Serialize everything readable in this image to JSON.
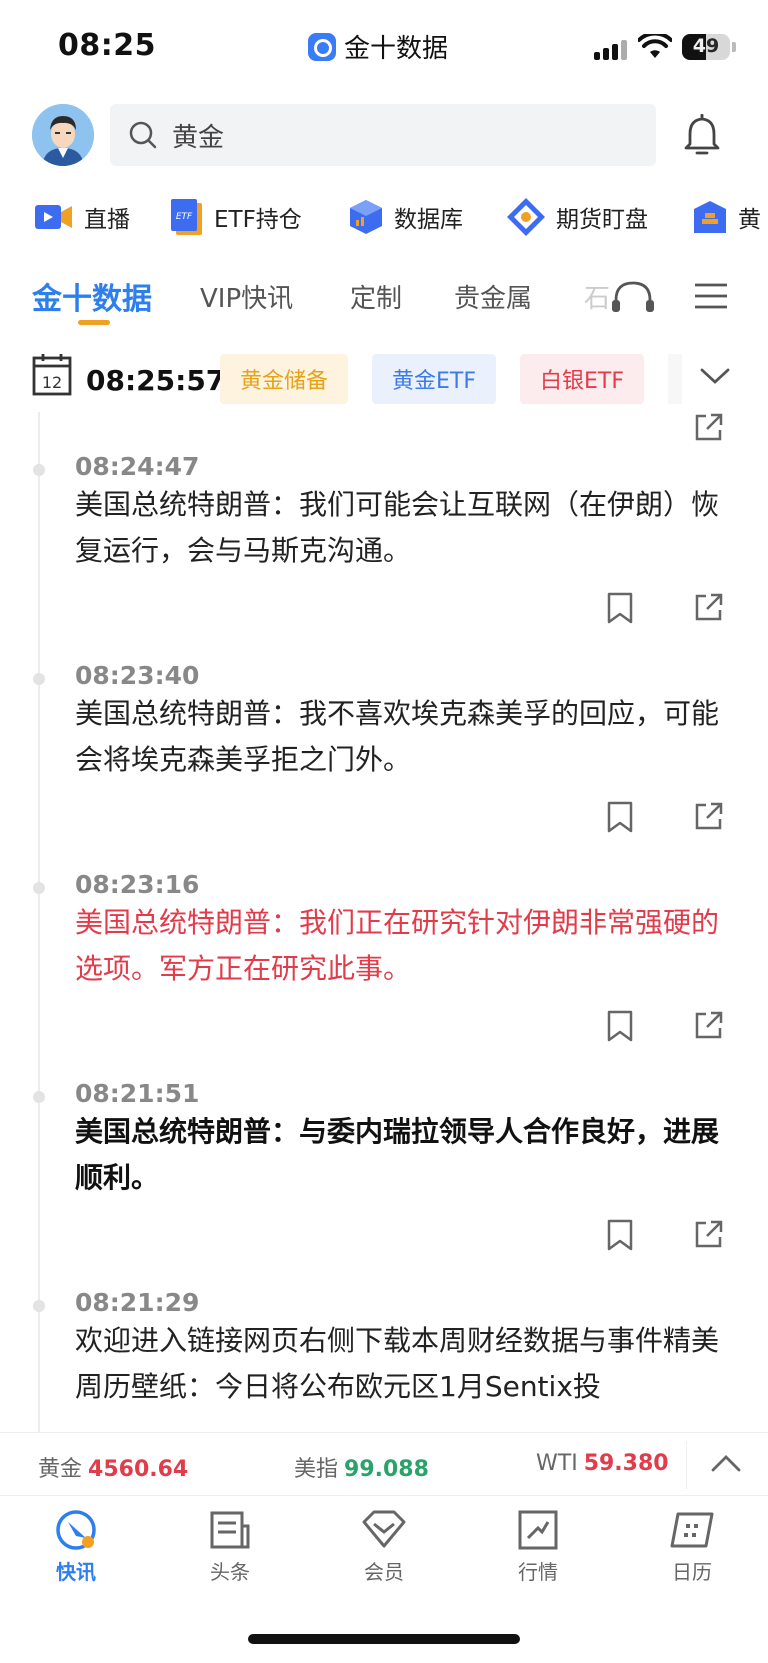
{
  "status": {
    "time": "08:25",
    "app_name": "金十数据",
    "battery": "49",
    "battery_level": 0.49
  },
  "search": {
    "value": "黄金"
  },
  "shortcuts": [
    {
      "label": "直播"
    },
    {
      "label": "ETF持仓",
      "icon_text": "ETF"
    },
    {
      "label": "数据库"
    },
    {
      "label": "期货盯盘"
    },
    {
      "label": "黄"
    }
  ],
  "tabs": [
    {
      "label": "金十数据"
    },
    {
      "label": "VIP快讯"
    },
    {
      "label": "定制"
    },
    {
      "label": "贵金属"
    },
    {
      "label": "石"
    }
  ],
  "tagrow": {
    "date_day": "12",
    "clock": "08:25:57",
    "tags": [
      {
        "label": "黄金储备",
        "color": "#e8a21a",
        "bg": "#fdf3de"
      },
      {
        "label": "黄金ETF",
        "color": "#3d7ae8",
        "bg": "#eaf1fd"
      },
      {
        "label": "白银ETF",
        "color": "#e23c4b",
        "bg": "#fdecee"
      }
    ]
  },
  "feed": [
    {
      "time": "08:24:47",
      "text": "美国总统特朗普：我们可能会让互联网（在伊朗）恢复运行，会与马斯克沟通。",
      "style": "normal"
    },
    {
      "time": "08:23:40",
      "text": "美国总统特朗普：我不喜欢埃克森美孚的回应，可能会将埃克森美孚拒之门外。",
      "style": "normal"
    },
    {
      "time": "08:23:16",
      "text": "美国总统特朗普：我们正在研究针对伊朗非常强硬的选项。军方正在研究此事。",
      "style": "red"
    },
    {
      "time": "08:21:51",
      "text": "美国总统特朗普：与委内瑞拉领导人合作良好，进展顺利。",
      "style": "bold"
    },
    {
      "time": "08:21:29",
      "text": "欢迎进入链接网页右侧下载本周财经数据与事件精美周历壁纸：今日将公布欧元区1月Sentix投",
      "style": "normal"
    }
  ],
  "ticker": [
    {
      "label": "黄金",
      "value": "4560.64",
      "color": "#e23c4b"
    },
    {
      "label": "美指",
      "value": "99.088",
      "color": "#2aa36b"
    },
    {
      "label": "WTI",
      "value": "59.380",
      "color": "#e23c4b"
    }
  ],
  "bottom_nav": [
    {
      "label": "快讯",
      "active": true
    },
    {
      "label": "头条"
    },
    {
      "label": "会员"
    },
    {
      "label": "行情"
    },
    {
      "label": "日历"
    }
  ],
  "colors": {
    "accent": "#2d7ff0",
    "tab_underline": "#f0a023",
    "red": "#e23c4b",
    "green": "#2aa36b"
  }
}
